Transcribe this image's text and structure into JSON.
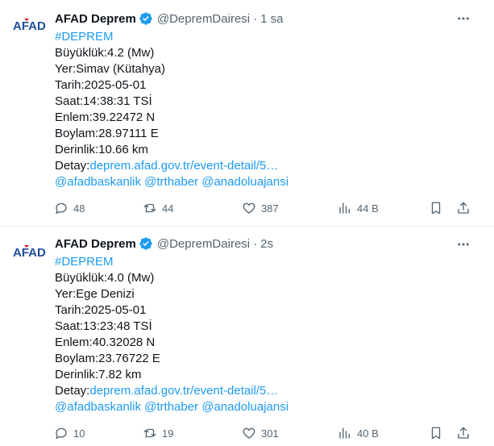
{
  "colors": {
    "link": "#1d9bf0",
    "verified": "#1d9bf0",
    "secondary_text": "#536471",
    "logo_blue": "#1f4e9c",
    "logo_red": "#e30a17"
  },
  "tweets": [
    {
      "avatar_icon": "afad-logo",
      "avatar_text": "AFAD",
      "name": "AFAD Deprem",
      "handle": "@DepremDairesi",
      "dot": "·",
      "time": "1 sa",
      "hashtag": "#DEPREM",
      "lines": [
        "Büyüklük:4.2 (Mw)",
        "Yer:Simav (Kütahya)",
        "Tarih:2025-05-01",
        "Saat:14:38:31 TSİ",
        "Enlem:39.22472 N",
        "Boylam:28.97111 E",
        "Derinlik:10.66 km"
      ],
      "detay_label": "Detay:",
      "detay_link": "deprem.afad.gov.tr/event-detail/5…",
      "mentions": [
        "@afadbaskanlik",
        "@trthaber",
        "@anadoluajansi"
      ],
      "stats": {
        "replies": "48",
        "reposts": "44",
        "likes": "387",
        "views": "44 B"
      }
    },
    {
      "avatar_icon": "afad-logo",
      "avatar_text": "AFAD",
      "name": "AFAD Deprem",
      "handle": "@DepremDairesi",
      "dot": "·",
      "time": "2s",
      "hashtag": "#DEPREM",
      "lines": [
        "Büyüklük:4.0 (Mw)",
        "Yer:Ege Denizi",
        "Tarih:2025-05-01",
        "Saat:13:23:48 TSİ",
        "Enlem:40.32028 N",
        "Boylam:23.76722 E",
        "Derinlik:7.82 km"
      ],
      "detay_label": "Detay:",
      "detay_link": "deprem.afad.gov.tr/event-detail/5…",
      "mentions": [
        "@afadbaskanlik",
        "@trthaber",
        "@anadoluajansi"
      ],
      "stats": {
        "replies": "10",
        "reposts": "19",
        "likes": "301",
        "views": "40 B"
      }
    }
  ]
}
